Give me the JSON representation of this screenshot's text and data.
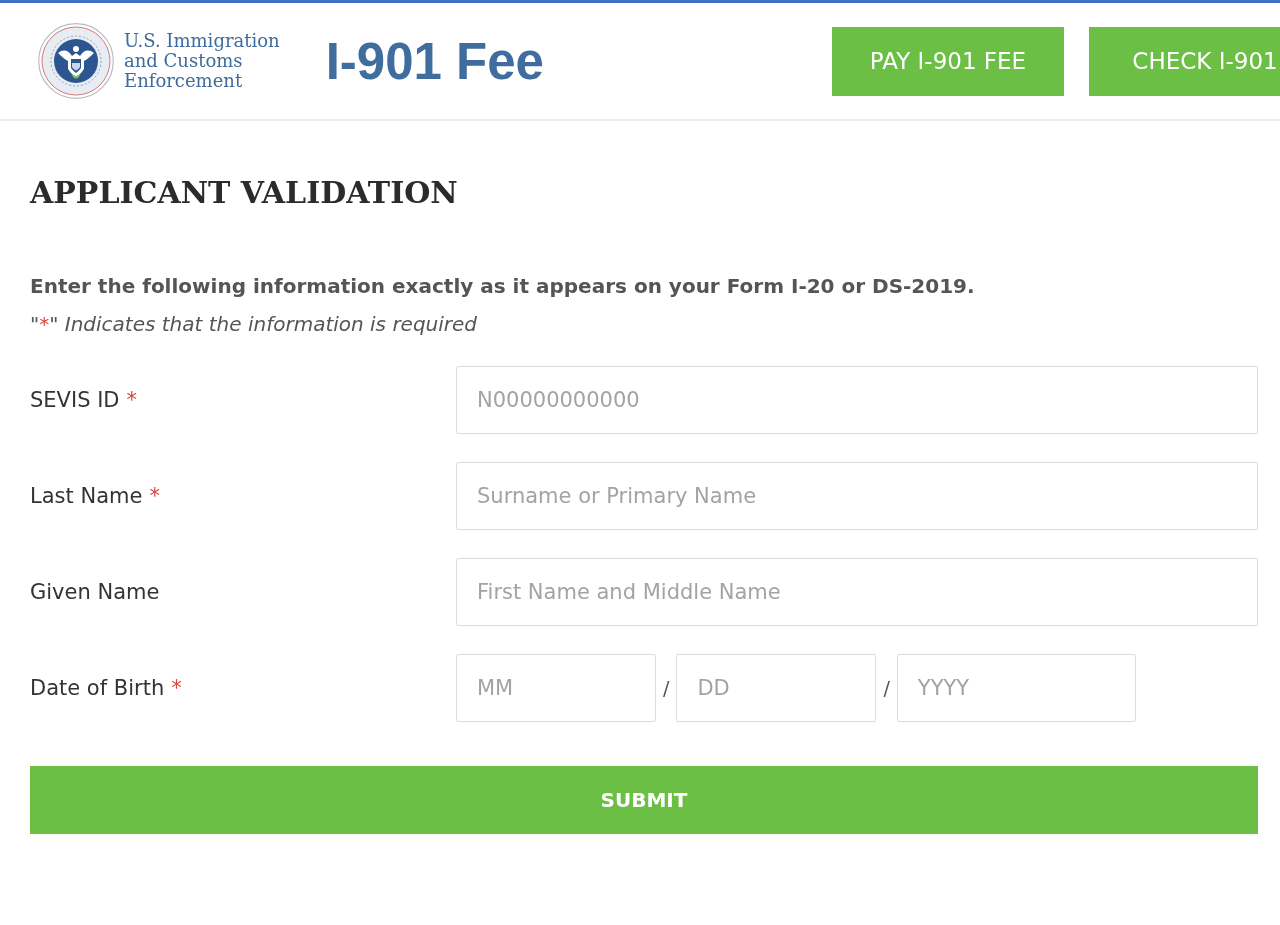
{
  "header": {
    "agency_name": [
      "U.S. Immigration",
      "and Customs",
      "Enforcement"
    ],
    "title": "I-901 Fee",
    "buttons": [
      {
        "label": "PAY I-901 FEE"
      },
      {
        "label": "CHECK I-901"
      }
    ]
  },
  "form": {
    "heading": "APPLICANT VALIDATION",
    "instructions": "Enter the following information exactly as it appears on your Form I-20 or DS-2019.",
    "required_note": {
      "quote_open": "\"",
      "mark": "*",
      "text": "\" Indicates that the information is required"
    },
    "fields": [
      {
        "kind": "text",
        "label": "SEVIS ID",
        "required_mark": "*",
        "placeholder": "N00000000000"
      },
      {
        "kind": "text",
        "label": "Last Name",
        "required_mark": "*",
        "placeholder": "Surname or Primary Name"
      },
      {
        "kind": "text",
        "label": "Given Name",
        "placeholder": "First Name and Middle Name"
      },
      {
        "kind": "date",
        "label": "Date of Birth",
        "required_mark": "*",
        "parts": [
          {
            "placeholder": "MM"
          },
          {
            "separator": "/",
            "placeholder": "DD"
          },
          {
            "separator": "/",
            "placeholder": "YYYY"
          }
        ]
      }
    ],
    "submit": {
      "label": "SUBMIT"
    }
  }
}
